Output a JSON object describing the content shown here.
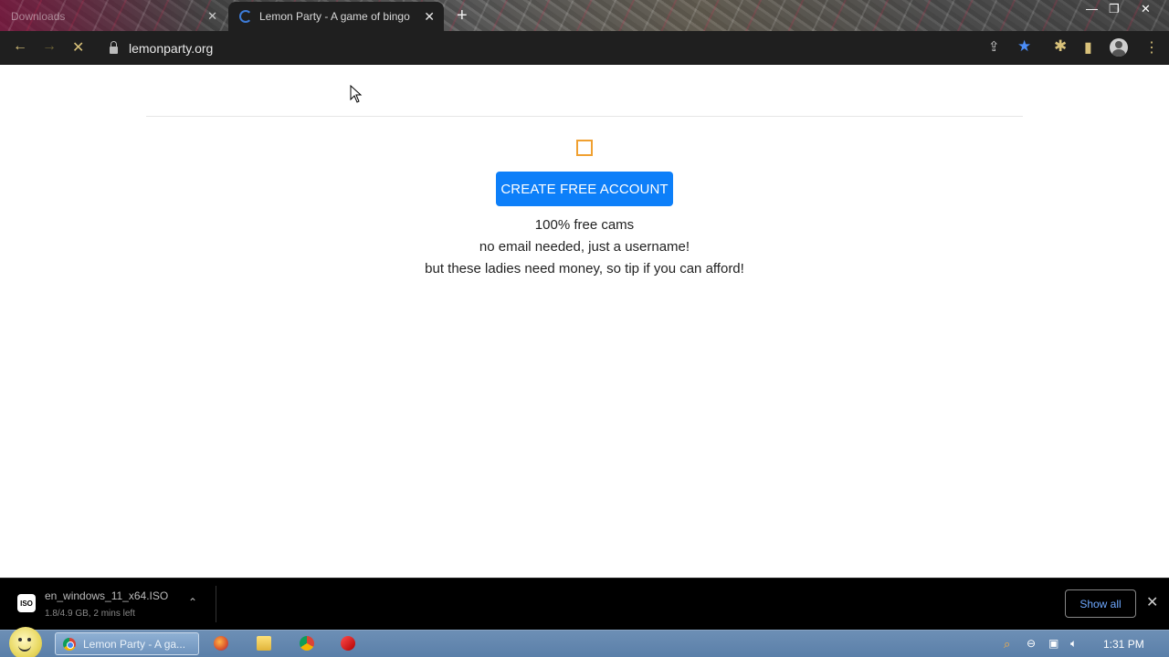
{
  "browser": {
    "tabs": [
      {
        "title": "Downloads",
        "active": false
      },
      {
        "title": "Lemon Party - A game of bingo",
        "active": true
      }
    ],
    "new_tab": "+",
    "close_glyph": "✕",
    "window_controls": {
      "minimize": "—",
      "restore": "❐",
      "close": "✕"
    },
    "toolbar": {
      "back": "←",
      "forward": "→",
      "stop": "✕",
      "url": "lemonparty.org",
      "share": "⇪",
      "bookmark": "★",
      "extensions": "✱",
      "sidepanel": "▮",
      "menu": "⋮"
    },
    "accent_color": "#0d7ff9"
  },
  "page": {
    "cta_label": "CREATE FREE ACCOUNT",
    "lines": [
      "100% free cams",
      "no email needed, just a username!",
      "but these ladies need money, so tip if you can afford!"
    ]
  },
  "downloads": {
    "file_name": "en_windows_11_x64.ISO",
    "status": "1.8/4.9 GB, 2 mins left",
    "icon_label": "ISO",
    "chevron": "⌃",
    "show_all": "Show all",
    "close": "✕"
  },
  "taskbar": {
    "task_label": "Lemon Party - A ga...",
    "clock": "1:31 PM"
  }
}
